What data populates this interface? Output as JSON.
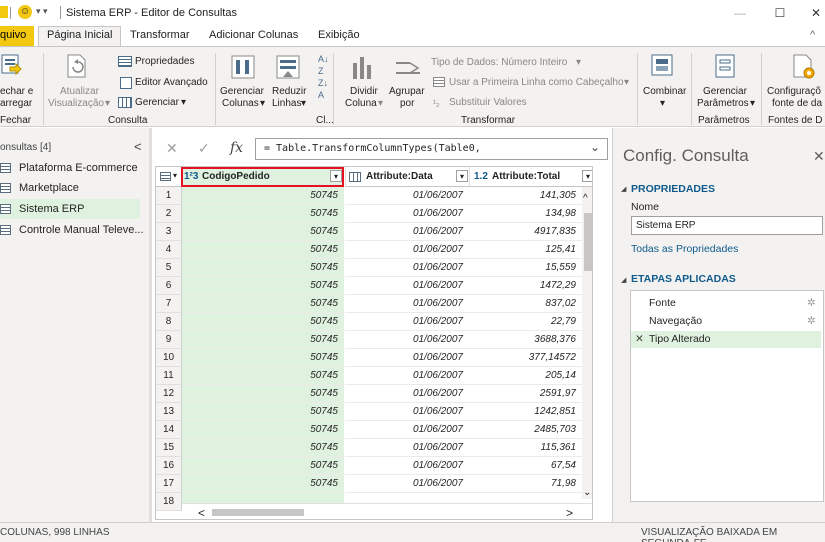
{
  "window": {
    "title": "Sistema ERP - Editor de Consultas",
    "controls": {
      "minimize": "—",
      "maximize": "☐",
      "close": "✕"
    }
  },
  "ribbon_tabs": [
    "quivo",
    "Página Inicial",
    "Transformar",
    "Adicionar Colunas",
    "Exibição"
  ],
  "ribbon": {
    "fechar": {
      "line1": "echar e",
      "line2": "arregar",
      "group": "Fechar"
    },
    "atualizar": {
      "line1": "Atualizar",
      "line2": "Visualização"
    },
    "propriedades": "Propriedades",
    "editor_avancado": "Editor Avançado",
    "gerenciar": "Gerenciar",
    "consulta_group": "Consulta",
    "gerenciar_colunas": {
      "line1": "Gerenciar",
      "line2": "Colunas"
    },
    "reduzir_linhas": {
      "line1": "Reduzir",
      "line2": "Linhas"
    },
    "cl_group": "Cl...",
    "dividir_coluna": {
      "line1": "Dividir",
      "line2": "Coluna"
    },
    "agrupar_por": {
      "line1": "Agrupar",
      "line2": "por"
    },
    "tipo_dados": "Tipo de Dados: Número Inteiro",
    "primeira_linha": "Usar a Primeira Linha como Cabeçalho",
    "substituir_valores": "Substituir Valores",
    "transformar_group": "Transformar",
    "combinar": "Combinar",
    "gerenciar_parametros": {
      "line1": "Gerenciar",
      "line2": "Parâmetros",
      "group": "Parâmetros"
    },
    "configuracoes_fonte": {
      "line1": "Configuraçõ",
      "line2": "fonte de da",
      "group": "Fontes de D"
    }
  },
  "left_pane": {
    "header": "onsultas [4]",
    "collapse": "<",
    "queries": [
      "Plataforma E-commerce",
      "Marketplace",
      "Sistema ERP",
      "Controle Manual Televe..."
    ],
    "selected_index": 2
  },
  "formula_bar": {
    "cancel": "✕",
    "confirm": "✓",
    "fx": "fx",
    "formula": "= Table.TransformColumnTypes(Table0,",
    "expand": "⌄"
  },
  "grid": {
    "columns": [
      {
        "type": "1²3",
        "name": "CodigoPedido"
      },
      {
        "type": "▦",
        "name": "Attribute:Data"
      },
      {
        "type": "1.2",
        "name": "Attribute:Total"
      }
    ],
    "rows": [
      [
        "1",
        "50745",
        "01/06/2007",
        "141,305"
      ],
      [
        "2",
        "50745",
        "01/06/2007",
        "134,98"
      ],
      [
        "3",
        "50745",
        "01/06/2007",
        "4917,835"
      ],
      [
        "4",
        "50745",
        "01/06/2007",
        "125,41"
      ],
      [
        "5",
        "50745",
        "01/06/2007",
        "15,559"
      ],
      [
        "6",
        "50745",
        "01/06/2007",
        "1472,29"
      ],
      [
        "7",
        "50745",
        "01/06/2007",
        "837,02"
      ],
      [
        "8",
        "50745",
        "01/06/2007",
        "22,79"
      ],
      [
        "9",
        "50745",
        "01/06/2007",
        "3688,376"
      ],
      [
        "10",
        "50745",
        "01/06/2007",
        "377,14572"
      ],
      [
        "11",
        "50745",
        "01/06/2007",
        "205,14"
      ],
      [
        "12",
        "50745",
        "01/06/2007",
        "2591,97"
      ],
      [
        "13",
        "50745",
        "01/06/2007",
        "1242,851"
      ],
      [
        "14",
        "50745",
        "01/06/2007",
        "2485,703"
      ],
      [
        "15",
        "50745",
        "01/06/2007",
        "115,361"
      ],
      [
        "16",
        "50745",
        "01/06/2007",
        "67,54"
      ],
      [
        "17",
        "50745",
        "01/06/2007",
        "71,98"
      ],
      [
        "18",
        "",
        "",
        ""
      ]
    ]
  },
  "right_pane": {
    "title": "Config. Consulta",
    "close": "✕",
    "properties_header": "PROPRIEDADES",
    "name_label": "Nome",
    "name_value": "Sistema ERP",
    "all_properties": "Todas as Propriedades",
    "steps_header": "ETAPAS APLICADAS",
    "steps": [
      "Fonte",
      "Navegação",
      "Tipo Alterado"
    ],
    "selected_step": 2
  },
  "status": {
    "left": "COLUNAS, 998 LINHAS",
    "right": "VISUALIZAÇÃO BAIXADA EM SEGUNDA-FE"
  },
  "colors": {
    "accent_yellow": "#f2c811",
    "selected_green": "#dff1df",
    "highlight_red": "#e81123",
    "section_blue": "#0f5a8c"
  }
}
